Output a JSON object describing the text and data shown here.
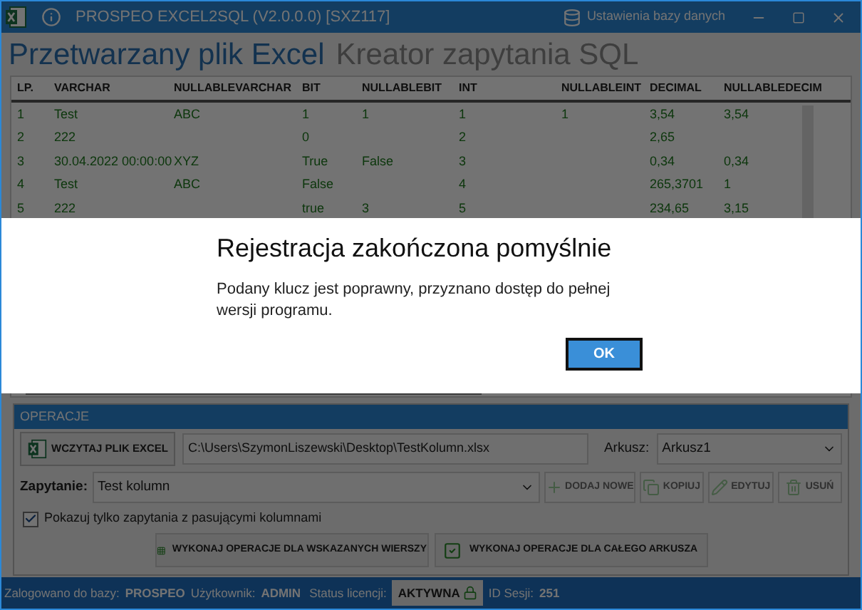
{
  "window": {
    "title": "PROSPEO EXCEL2SQL (V2.0.0.0) [SXZ117]",
    "db_settings": "Ustawienia bazy danych"
  },
  "tabs": [
    {
      "label": "Przetwarzany plik Excel",
      "selected": true
    },
    {
      "label": "Kreator zapytania SQL",
      "selected": false
    }
  ],
  "table": {
    "columns": [
      "LP.",
      "VARCHAR",
      "NULLABLEVARCHAR",
      "BIT",
      "NULLABLEBIT",
      "INT",
      "NULLABLEINT",
      "DECIMAL",
      "NULLABLEDECIM"
    ],
    "rows": [
      [
        "1",
        "Test",
        "ABC",
        "1",
        "1",
        "1",
        "1",
        "3,54",
        "3,54"
      ],
      [
        "2",
        "222",
        "",
        "0",
        "",
        "2",
        "",
        "2,65",
        ""
      ],
      [
        "3",
        "30.04.2022 00:00:00",
        "XYZ",
        "True",
        "False",
        "3",
        "",
        "0,34",
        "0,34"
      ],
      [
        "4",
        "Test",
        "ABC",
        "False",
        "",
        "4",
        "",
        "265,3701",
        "1"
      ],
      [
        "5",
        "222",
        "",
        "true",
        "3",
        "5",
        "",
        "234,65",
        "3,15"
      ]
    ]
  },
  "operations": {
    "title": "OPERACJE",
    "load_button": "WCZYTAJ PLIK EXCEL",
    "file_path": "C:\\Users\\SzymonLiszewski\\Desktop\\TestKolumn.xlsx",
    "sheet_label": "Arkusz:",
    "sheet_value": "Arkusz1",
    "query_label": "Zapytanie:",
    "query_value": "Test kolumn",
    "actions": [
      {
        "kind": "add",
        "label": "DODAJ NOWE",
        "disabled": true
      },
      {
        "kind": "copy",
        "label": "KOPIUJ",
        "disabled": true
      },
      {
        "kind": "edit",
        "label": "EDYTUJ",
        "disabled": true
      },
      {
        "kind": "delete",
        "label": "USUŃ",
        "disabled": true
      }
    ],
    "filter": {
      "label": "Pokazuj tylko zapytania z pasującymi kolumnami",
      "checked": true
    },
    "run_buttons": [
      {
        "kind": "selected_rows",
        "label": "WYKONAJ OPERACJE DLA WSKAZANYCH WIERSZY"
      },
      {
        "kind": "whole_sheet",
        "label": "WYKONAJ OPERACJE DLA CAŁEGO ARKUSZA"
      }
    ]
  },
  "status_bar": {
    "db_label": "Zalogowano do bazy:",
    "db_value": "PROSPEO",
    "user_label": "Użytkownik:",
    "user_value": "ADMIN",
    "license_label": "Status licencji:",
    "license_value": "AKTYWNA",
    "session_label": "ID Sesji:",
    "session_value": "251"
  },
  "dialog": {
    "title": "Rejestracja zakończona pomyślnie",
    "message": "Podany klucz jest poprawny, przyznano dostęp do pełnej wersji programu.",
    "ok": "OK"
  }
}
